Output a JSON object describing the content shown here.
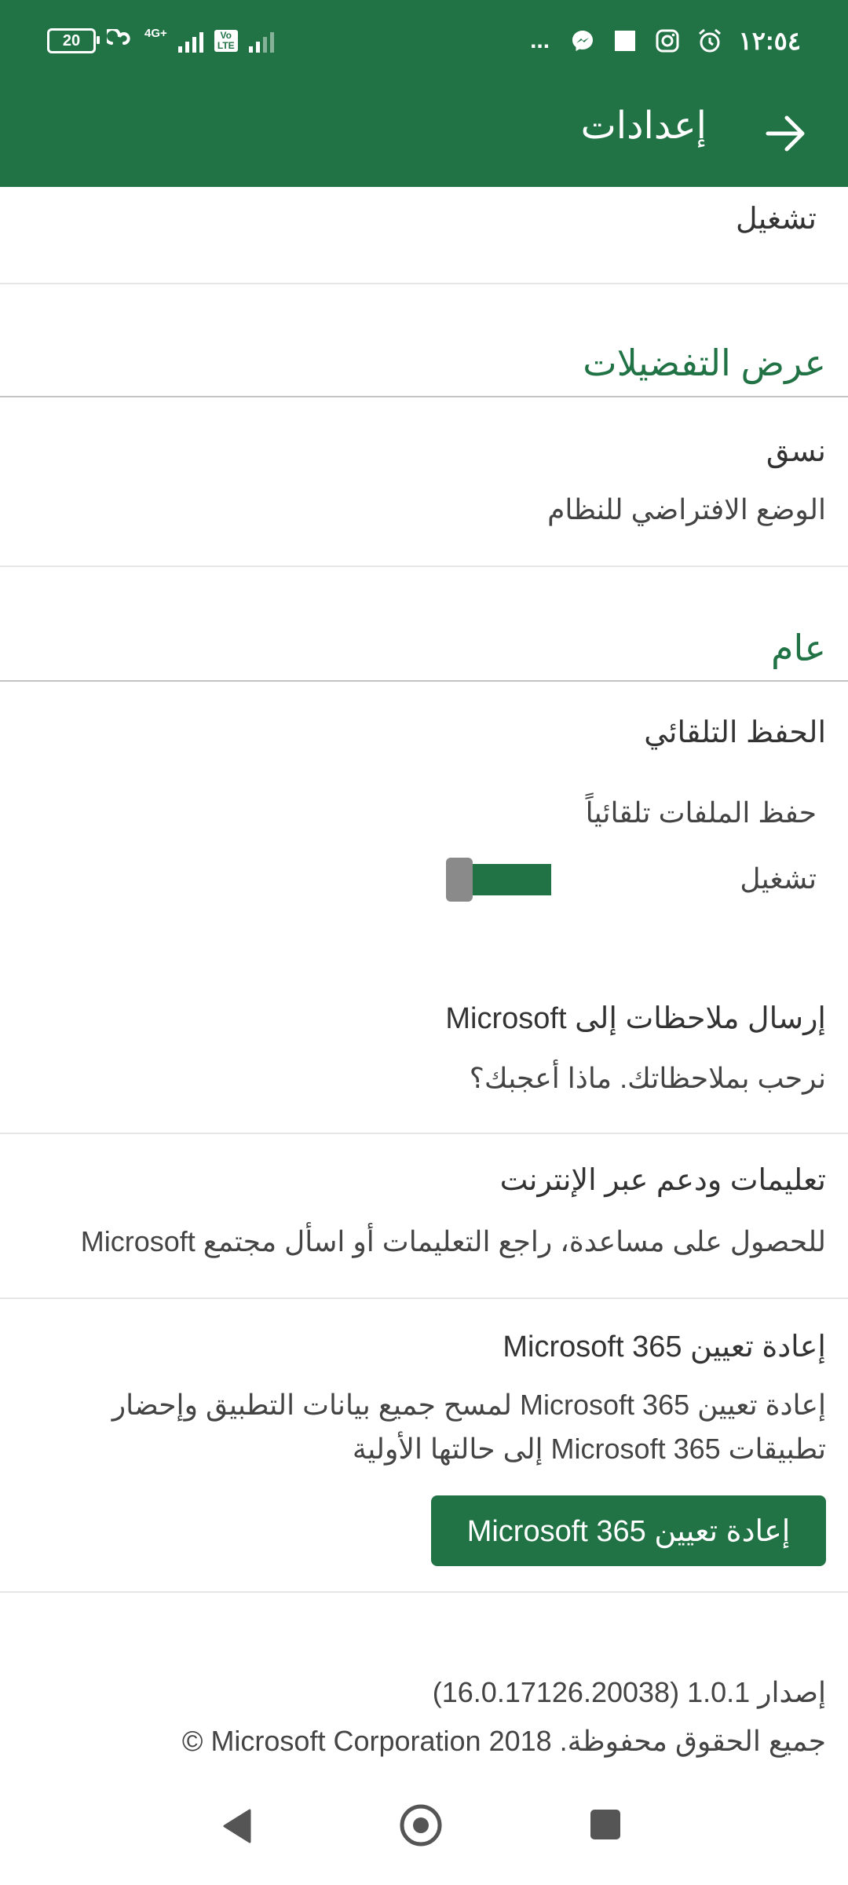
{
  "status_bar": {
    "battery": "20",
    "network": "4G+",
    "volte": "Vo LTE",
    "time": "١٢:٥٤",
    "more": "..."
  },
  "app_bar": {
    "title": "إعدادات"
  },
  "sections": {
    "top_value": "تشغيل",
    "display": {
      "header": "عرض التفضيلات",
      "theme_label": "نسق",
      "theme_value": "الوضع الافتراضي للنظام"
    },
    "general": {
      "header": "عام",
      "autosave_title": "الحفظ التلقائي",
      "autosave_files_label": "حفظ الملفات تلقائياً",
      "autosave_state": "تشغيل",
      "autosave_on": true
    },
    "feedback": {
      "title": "إرسال ملاحظات إلى Microsoft",
      "subtitle": "نرحب بملاحظاتك. ماذا أعجبك؟"
    },
    "help": {
      "title": "تعليمات ودعم عبر الإنترنت",
      "subtitle": "للحصول على مساعدة، راجع التعليمات أو اسأل مجتمع Microsoft"
    },
    "reset": {
      "title": "إعادة تعيين Microsoft 365",
      "description_line1": "إعادة تعيين Microsoft 365 لمسح جميع بيانات التطبيق وإحضار",
      "description_line2": "تطبيقات Microsoft 365 إلى حالتها الأولية",
      "button_label": "إعادة تعيين Microsoft 365"
    },
    "about": {
      "version": "إصدار 1.0.1 (16.0.17126.20038)",
      "copyright": "جميع الحقوق محفوظة. Microsoft Corporation 2018 ©"
    }
  },
  "colors": {
    "accent": "#217346",
    "toggle_thumb": "#8a8a8a"
  }
}
